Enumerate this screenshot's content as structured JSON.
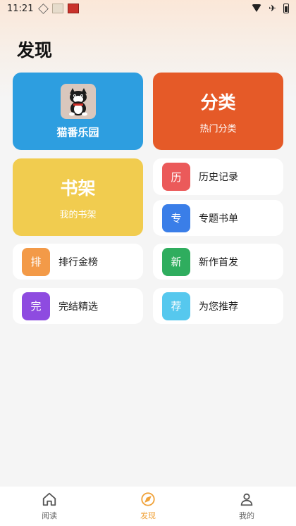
{
  "status_bar": {
    "time": "11:21"
  },
  "page": {
    "title": "发现"
  },
  "feature_cards": {
    "park": {
      "label": "猫番乐园",
      "color": "#2d9ee0"
    },
    "category": {
      "title": "分类",
      "subtitle": "热门分类",
      "color": "#e55a28"
    },
    "shelf": {
      "title": "书架",
      "subtitle": "我的书架",
      "color": "#f1cc4f"
    }
  },
  "entries": [
    {
      "badge": "历",
      "label": "历史记录",
      "color": "#eb5a5a"
    },
    {
      "badge": "专",
      "label": "专题书单",
      "color": "#3a7ee8"
    },
    {
      "badge": "排",
      "label": "排行金榜",
      "color": "#f39a48"
    },
    {
      "badge": "新",
      "label": "新作首发",
      "color": "#2fad5e"
    },
    {
      "badge": "完",
      "label": "完结精选",
      "color": "#8e4be0"
    },
    {
      "badge": "荐",
      "label": "为您推荐",
      "color": "#56c8ee"
    }
  ],
  "bottom_nav": {
    "items": [
      {
        "label": "阅读",
        "icon": "home-icon"
      },
      {
        "label": "发现",
        "icon": "compass-icon",
        "active": true
      },
      {
        "label": "我的",
        "icon": "person-icon"
      }
    ],
    "active_color": "#f0a23a"
  }
}
